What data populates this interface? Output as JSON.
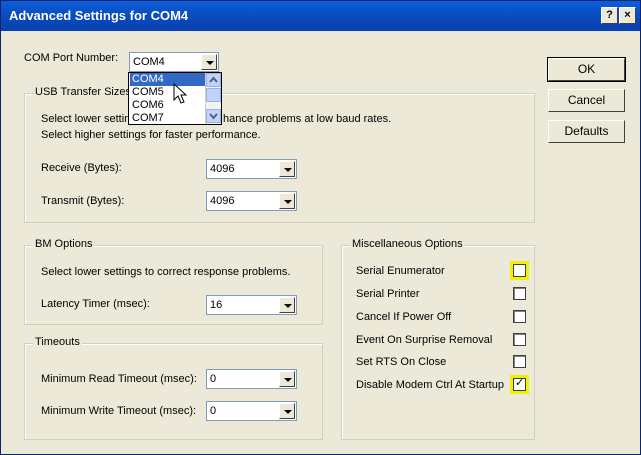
{
  "window": {
    "title": "Advanced Settings for COM4",
    "help_label": "?",
    "close_label": "×"
  },
  "com_port": {
    "label": "COM Port Number:",
    "value": "COM4",
    "options": [
      "COM4",
      "COM5",
      "COM6",
      "COM7"
    ]
  },
  "usb_transfer": {
    "title": "USB Transfer Sizes",
    "desc1": "Select lower settin",
    "desc1b": "hance problems at low baud rates.",
    "desc2": "Select higher settings for faster performance.",
    "receive_label": "Receive (Bytes):",
    "receive_value": "4096",
    "transmit_label": "Transmit (Bytes):",
    "transmit_value": "4096"
  },
  "bm_options": {
    "title": "BM Options",
    "desc": "Select lower settings to correct response problems.",
    "latency_label": "Latency Timer (msec):",
    "latency_value": "16"
  },
  "timeouts": {
    "title": "Timeouts",
    "min_read_label": "Minimum Read Timeout (msec):",
    "min_read_value": "0",
    "min_write_label": "Minimum Write Timeout (msec):",
    "min_write_value": "0"
  },
  "misc": {
    "title": "Miscellaneous Options",
    "options": [
      {
        "label": "Serial Enumerator",
        "checked": false,
        "highlighted": true
      },
      {
        "label": "Serial Printer",
        "checked": false,
        "highlighted": false
      },
      {
        "label": "Cancel If Power Off",
        "checked": false,
        "highlighted": false
      },
      {
        "label": "Event On Surprise Removal",
        "checked": false,
        "highlighted": false
      },
      {
        "label": "Set RTS On Close",
        "checked": false,
        "highlighted": false
      },
      {
        "label": "Disable Modem Ctrl At Startup",
        "checked": true,
        "highlighted": true
      }
    ]
  },
  "buttons": {
    "ok": "OK",
    "cancel": "Cancel",
    "defaults": "Defaults"
  },
  "colors": {
    "title_bar": "#0a4fc2",
    "dialog_bg": "#ece9d8",
    "selection": "#316ac5",
    "highlight": "#f2f200"
  }
}
